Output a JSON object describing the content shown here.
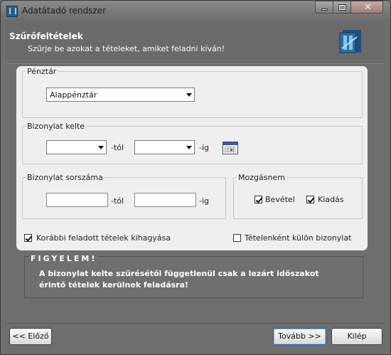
{
  "window": {
    "title": "Adatátadó rendszer"
  },
  "header": {
    "title": "Szűrőfeltételek",
    "subtitle": "Szűrje be azokat a tételeket, amiket feladni kíván!"
  },
  "penztar": {
    "legend": "Pénztár",
    "selected": "Alappénztár"
  },
  "bizonylat_kelte": {
    "legend": "Bizonylat kelte",
    "from_value": "",
    "to_value": "",
    "from_suffix": "-tól",
    "to_suffix": "-ig"
  },
  "bizonylat_sorszama": {
    "legend": "Bizonylat sorszáma",
    "from_value": "",
    "to_value": "",
    "from_suffix": "-tól",
    "to_suffix": "-ig"
  },
  "mozgasnem": {
    "legend": "Mozgásnem",
    "bevetel_label": "Bevétel",
    "bevetel_checked": true,
    "kiadas_label": "Kiadás",
    "kiadas_checked": true
  },
  "options": {
    "skip_label": "Korábbi feladott tételek kihagyása",
    "skip_checked": true,
    "separate_label": "Tételenként külön bizonylat",
    "separate_checked": false
  },
  "warning": {
    "title": "FIGYELEM!",
    "text": "A bizonylat kelte szűrésétől függetlenül csak a lezárt időszakot érintő tételek kerülnek feladásra!"
  },
  "buttons": {
    "prev": "<< Előző",
    "next": "Tovább >>",
    "exit": "Kilép"
  },
  "colors": {
    "window_bg": "#6e6e6e",
    "card_bg": "#efefef",
    "default_button_border": "#2a5aa3"
  }
}
